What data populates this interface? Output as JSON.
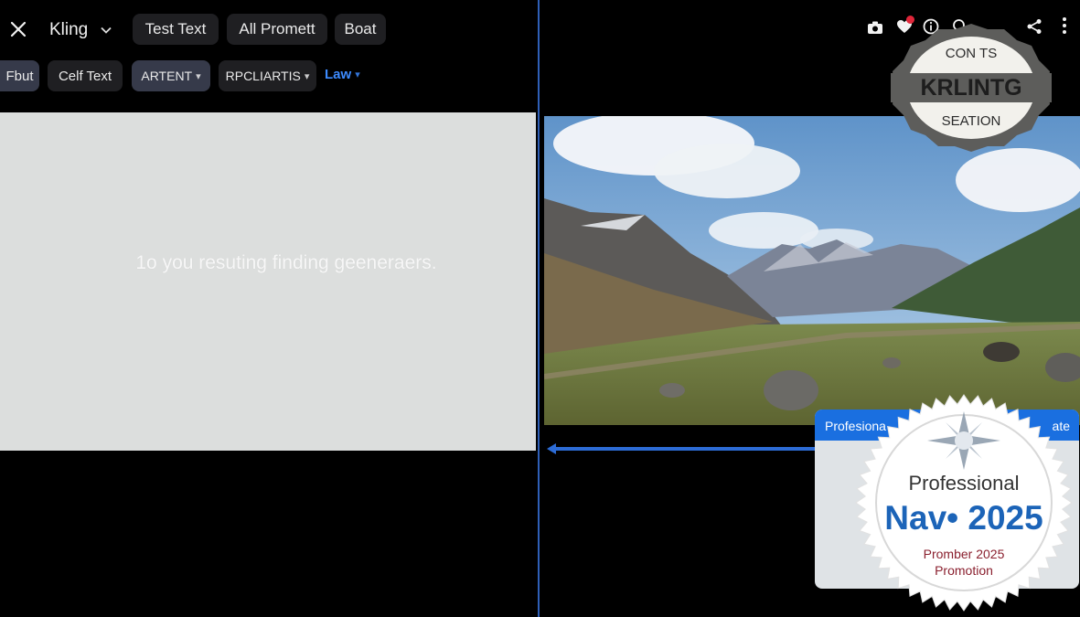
{
  "toolbar": {
    "app_name": "Kling",
    "tabs": [
      "Test Text",
      "All Promett",
      "Boat"
    ]
  },
  "subbar": {
    "items": [
      {
        "label": "Fbut",
        "dropdown": false
      },
      {
        "label": "Celf Text",
        "dropdown": false
      },
      {
        "label": "ARTENT",
        "dropdown": true
      },
      {
        "label": "RPCLIARTIS",
        "dropdown": true
      },
      {
        "label": "Law",
        "dropdown": true
      }
    ]
  },
  "icons": {
    "close": "close-icon",
    "chevron": "chevron-down-icon",
    "right_toolbar": [
      "camera-icon",
      "heart-icon",
      "info-icon",
      "search-icon",
      "share-icon",
      "more-vertical-icon"
    ]
  },
  "left_panel": {
    "text": "1o you resuting finding geeneraers."
  },
  "badge_top": {
    "line1": "CON TS",
    "line2": "KRLINTG",
    "line3": "SEATION"
  },
  "promo_card": {
    "header_left": "Profesiona",
    "header_right": "ate",
    "seal_title": "Professional",
    "seal_headline": "Nav• 2025",
    "seal_line1": "Promber 2025",
    "seal_line2": "Promotion"
  },
  "colors": {
    "background": "#000000",
    "accent_blue": "#2d6cd6",
    "link_blue": "#3d8bff",
    "panel_gray": "#dcdedd",
    "notification_red": "#e0263a",
    "seal_blue": "#1c64b8",
    "seal_red": "#8a1f2e"
  }
}
